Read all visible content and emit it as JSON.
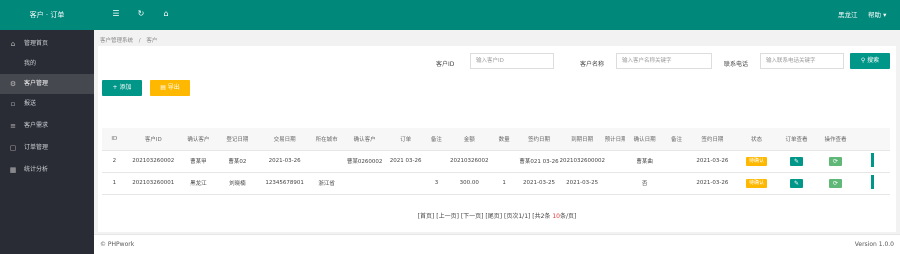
{
  "app": {
    "title": "客户 · 订单"
  },
  "topbar": {
    "icons": [
      "menu-icon",
      "refresh-icon",
      "home-icon"
    ],
    "user_name": "黑龙江",
    "user_menu": "帮助 ▾"
  },
  "sidebar": {
    "items": [
      {
        "label": "管理首页",
        "icon": "home-icon"
      },
      {
        "label": "我的",
        "icon": "user-icon"
      },
      {
        "label": "客户管理",
        "icon": "gear-icon",
        "active": true
      },
      {
        "label": "报送",
        "icon": "doc-icon"
      },
      {
        "label": "客户需求",
        "icon": "list-icon"
      },
      {
        "label": "订单管理",
        "icon": "cart-icon"
      },
      {
        "label": "统计分析",
        "icon": "chart-icon"
      }
    ]
  },
  "breadcrumb": {
    "parent": "客户管理系统",
    "sep": "/",
    "current": "客户"
  },
  "filters": {
    "client_id_label": "客户ID",
    "client_id_placeholder": "输入客户ID",
    "client_name_label": "客户名称",
    "client_name_placeholder": "输入客户名称关键字",
    "contact_label": "联系电话",
    "contact_placeholder": "输入联系电话关键字",
    "search_button": "搜索"
  },
  "actions": {
    "add_button": "+ 添加",
    "export_button": "导出"
  },
  "table": {
    "headers": [
      "ID",
      "客户ID",
      "确认客户",
      "登记日期",
      "交易日期",
      "所在城市",
      "确认客户",
      "订单",
      "备注",
      "金额",
      "数量",
      "签约日期",
      "到期日期",
      "预计日期",
      "确认日期",
      "备注",
      "签约日期",
      "状态",
      "订单查看",
      "操作查看",
      ""
    ],
    "rows": [
      {
        "id": "2",
        "client_id": "202103260002",
        "confirm": "曹某甲",
        "reg_date": "曹某02",
        "trade_date": "2021-03-26",
        "city": "",
        "confirm2": "曹某0260002",
        "order": "2021 03-26",
        "remark": "",
        "amount": "20210326002",
        "qty": "",
        "sign_date": "曹某021 03-26",
        "due_date": "2021032600002",
        "plan_date": "",
        "confirm_date": "曹某曲",
        "remark2": "",
        "sign_date2": "2021-03-26",
        "status": "待确认",
        "op1": "✎",
        "op2": "⟳"
      },
      {
        "id": "1",
        "client_id": "202103260001",
        "confirm": "黑龙江",
        "reg_date": "刘晓楠",
        "trade_date": "12345678901",
        "city": "浙江省",
        "confirm2": "",
        "order": "",
        "remark": "3",
        "amount": "300.00",
        "qty": "1",
        "sign_date": "2021-03-25",
        "due_date": "2021-03-25",
        "plan_date": "",
        "confirm_date": "否",
        "remark2": "",
        "sign_date2": "2021-03-26",
        "status": "待确认",
        "op1": "✎",
        "op2": "⟳"
      }
    ]
  },
  "pager": {
    "text_before": "[首页] [上一页] [下一页] [尾页] [页次1/1] [共2条 ",
    "count": "10",
    "text_after": "条/页]"
  },
  "footer": {
    "left": "© PHPwork",
    "right": "Version 1.0.0"
  },
  "colors": {
    "primary": "#009688",
    "topbar": "#00897b",
    "sidebar": "#2a2c35",
    "warning": "#ffb800"
  }
}
